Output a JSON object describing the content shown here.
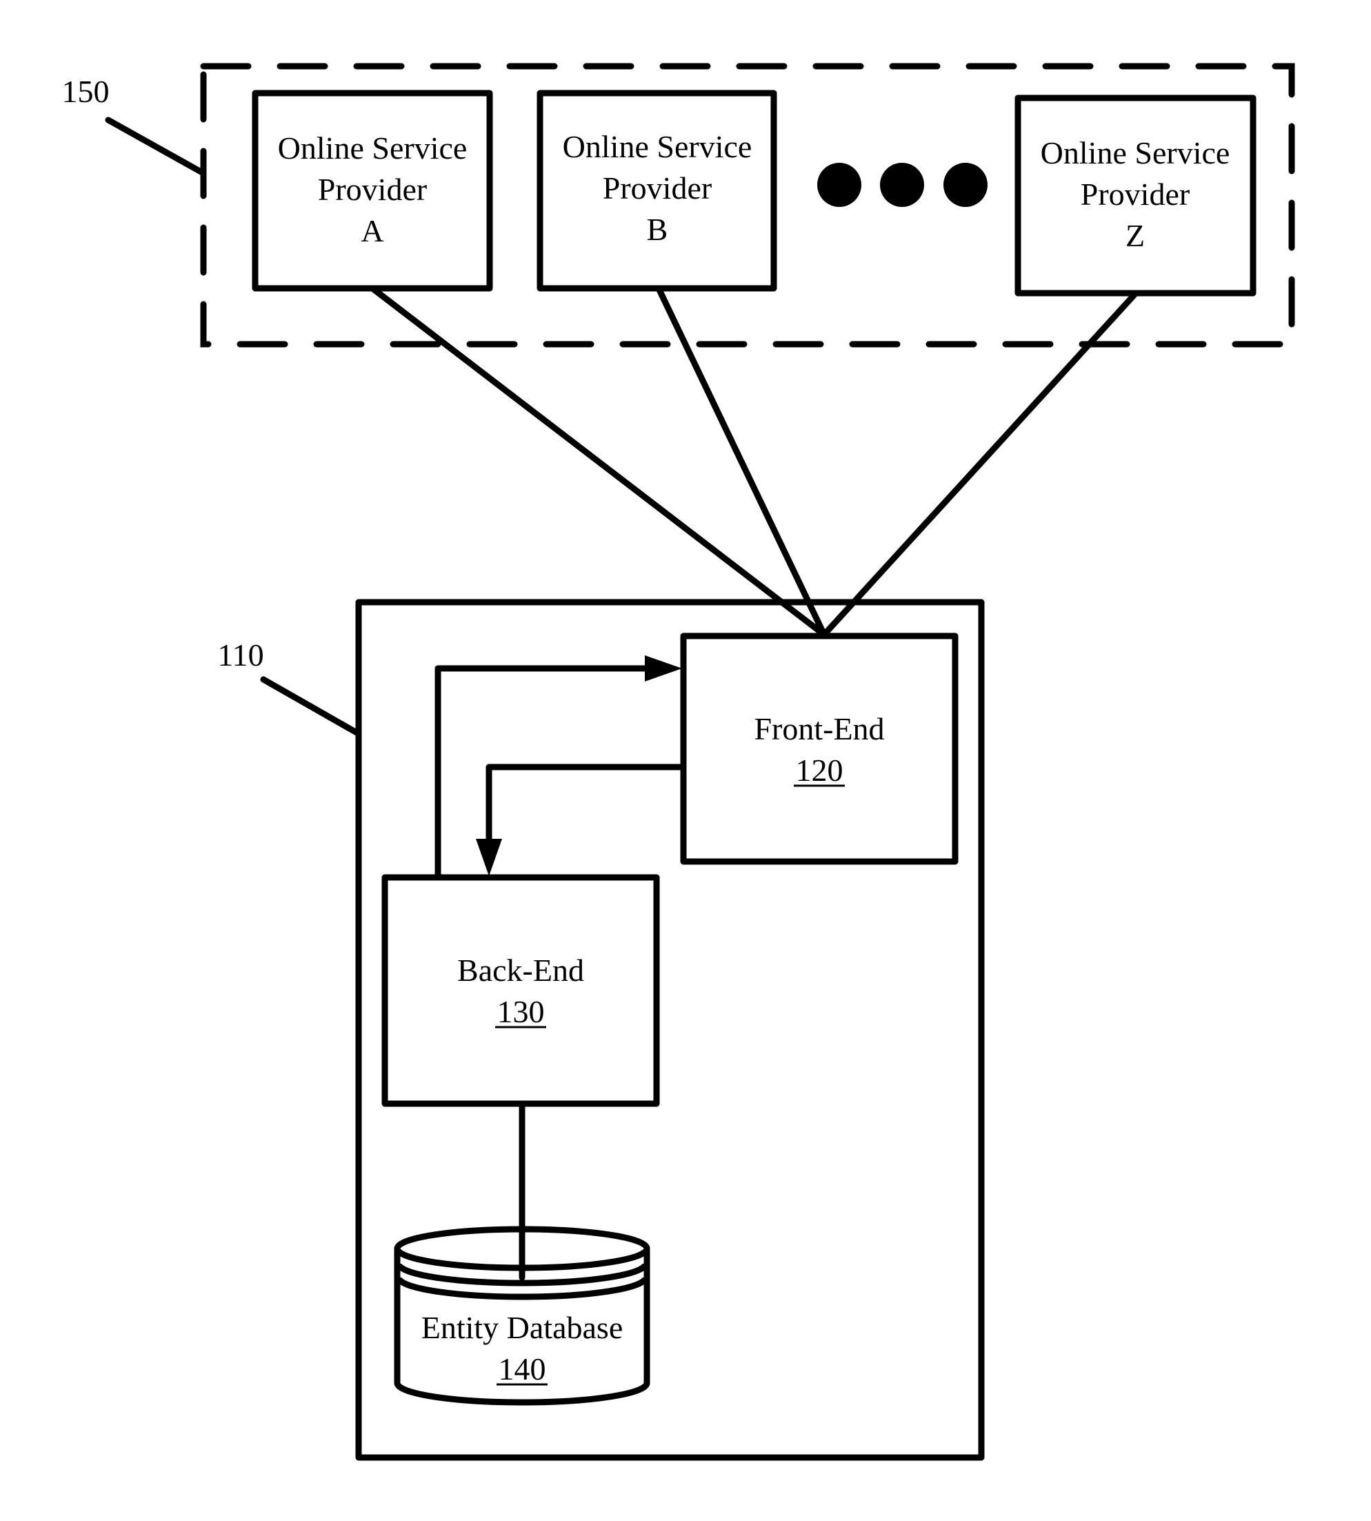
{
  "diagram": {
    "group_150": {
      "ref": "150",
      "providers": [
        {
          "line1": "Online Service",
          "line2": "Provider",
          "line3": "A"
        },
        {
          "line1": "Online Service",
          "line2": "Provider",
          "line3": "B"
        },
        {
          "line1": "Online Service",
          "line2": "Provider",
          "line3": "Z"
        }
      ],
      "ellipsis_icon": "three-dots-icon"
    },
    "system_110": {
      "ref": "110",
      "front_end": {
        "label": "Front-End",
        "ref": "120"
      },
      "back_end": {
        "label": "Back-End",
        "ref": "130"
      },
      "database": {
        "label": "Entity Database",
        "ref": "140"
      }
    }
  },
  "colors": {
    "ink": "#000000",
    "background": "#ffffff"
  }
}
